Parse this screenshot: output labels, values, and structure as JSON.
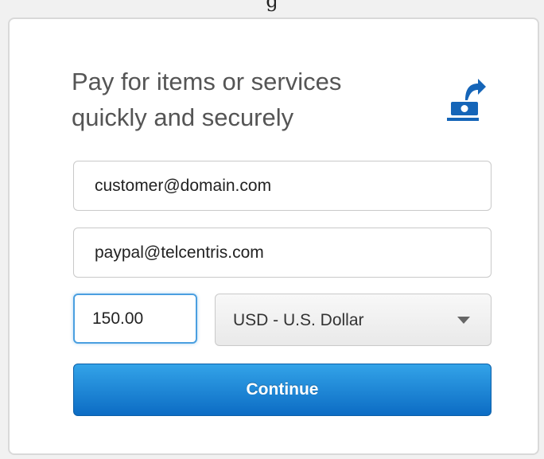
{
  "top_cut_text": "g",
  "card": {
    "headline": "Pay for items or services quickly and securely",
    "icon": "send-money-icon"
  },
  "form": {
    "email_value": "customer@domain.com",
    "recipient_value": "paypal@telcentris.com",
    "amount_value": "150.00",
    "currency_selected": "USD - U.S. Dollar",
    "continue_label": "Continue"
  },
  "colors": {
    "accent": "#1a7fd4",
    "icon_blue": "#1565b8"
  }
}
